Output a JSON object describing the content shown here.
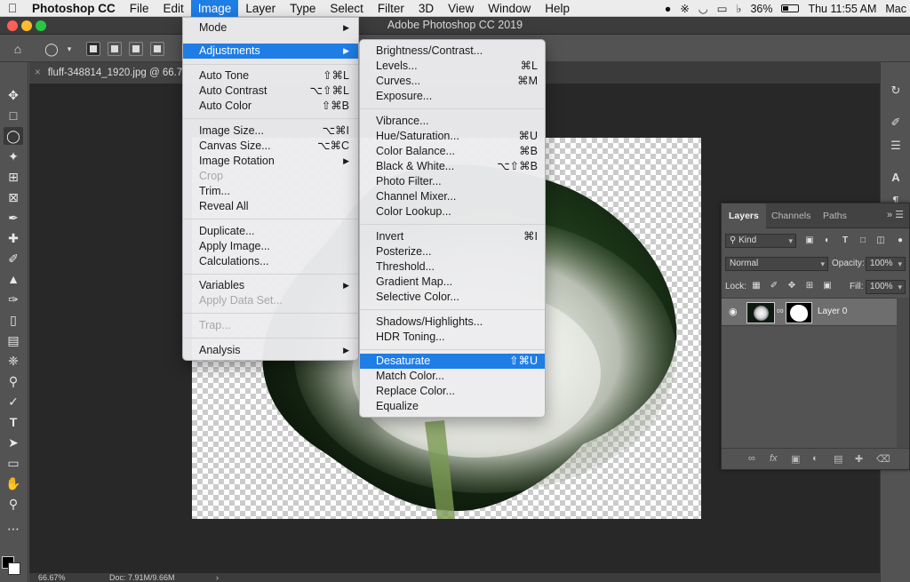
{
  "menubar": {
    "app": "Photoshop CC",
    "items": [
      "File",
      "Edit",
      "Image",
      "Layer",
      "Type",
      "Select",
      "Filter",
      "3D",
      "View",
      "Window",
      "Help"
    ],
    "battery": "36%",
    "clock": "Thu 11:55 AM",
    "user": "Mac"
  },
  "window": {
    "title": "Adobe Photoshop CC 2019"
  },
  "document": {
    "tab_label": "fluff-348814_1920.jpg @ 66.7",
    "zoom": "66.67%",
    "doc_size": "Doc: 7.91M/9.66M",
    "more": "›"
  },
  "image_menu": {
    "items": [
      {
        "label": "Mode",
        "submenu": true
      },
      {
        "label": "Adjustments",
        "submenu": true
      },
      {
        "label": "Auto Tone",
        "shortcut": "⇧⌘L"
      },
      {
        "label": "Auto Contrast",
        "shortcut": "⌥⇧⌘L"
      },
      {
        "label": "Auto Color",
        "shortcut": "⇧⌘B"
      },
      {
        "label": "Image Size...",
        "shortcut": "⌥⌘I"
      },
      {
        "label": "Canvas Size...",
        "shortcut": "⌥⌘C"
      },
      {
        "label": "Image Rotation",
        "submenu": true
      },
      {
        "label": "Crop"
      },
      {
        "label": "Trim..."
      },
      {
        "label": "Reveal All"
      },
      {
        "label": "Duplicate..."
      },
      {
        "label": "Apply Image..."
      },
      {
        "label": "Calculations..."
      },
      {
        "label": "Variables",
        "submenu": true
      },
      {
        "label": "Apply Data Set..."
      },
      {
        "label": "Trap..."
      },
      {
        "label": "Analysis",
        "submenu": true
      }
    ]
  },
  "adjustments_menu": {
    "items": [
      {
        "label": "Brightness/Contrast..."
      },
      {
        "label": "Levels...",
        "shortcut": "⌘L"
      },
      {
        "label": "Curves...",
        "shortcut": "⌘M"
      },
      {
        "label": "Exposure..."
      },
      {
        "label": "Vibrance..."
      },
      {
        "label": "Hue/Saturation...",
        "shortcut": "⌘U"
      },
      {
        "label": "Color Balance...",
        "shortcut": "⌘B"
      },
      {
        "label": "Black & White...",
        "shortcut": "⌥⇧⌘B"
      },
      {
        "label": "Photo Filter..."
      },
      {
        "label": "Channel Mixer..."
      },
      {
        "label": "Color Lookup..."
      },
      {
        "label": "Invert",
        "shortcut": "⌘I"
      },
      {
        "label": "Posterize..."
      },
      {
        "label": "Threshold..."
      },
      {
        "label": "Gradient Map..."
      },
      {
        "label": "Selective Color..."
      },
      {
        "label": "Shadows/Highlights..."
      },
      {
        "label": "HDR Toning..."
      },
      {
        "label": "Desaturate",
        "shortcut": "⇧⌘U"
      },
      {
        "label": "Match Color..."
      },
      {
        "label": "Replace Color..."
      },
      {
        "label": "Equalize"
      }
    ]
  },
  "layers_panel": {
    "tabs": [
      "Layers",
      "Channels",
      "Paths"
    ],
    "kind_filter": "Kind",
    "blend_mode": "Normal",
    "opacity_label": "Opacity:",
    "opacity": "100%",
    "lock_label": "Lock:",
    "fill_label": "Fill:",
    "fill": "100%",
    "layer_name": "Layer 0"
  },
  "colors": {
    "menu_highlight": "#1f7de6",
    "panel_bg": "#535353",
    "canvas_bg": "#282828"
  }
}
